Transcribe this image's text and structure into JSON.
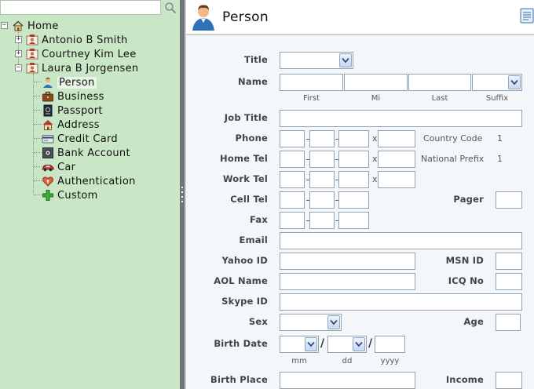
{
  "search": {
    "value": "",
    "placeholder": ""
  },
  "tree": {
    "root": "Home",
    "contacts": [
      {
        "name": "Antonio B Smith"
      },
      {
        "name": "Courtney Kim Lee"
      },
      {
        "name": "Laura B Jorgensen"
      }
    ],
    "children": [
      {
        "label": "Person",
        "icon": "person-icon"
      },
      {
        "label": "Business",
        "icon": "briefcase-icon"
      },
      {
        "label": "Passport",
        "icon": "passport-icon"
      },
      {
        "label": "Address",
        "icon": "house-icon"
      },
      {
        "label": "Credit Card",
        "icon": "credit-card-icon"
      },
      {
        "label": "Bank Account",
        "icon": "safe-icon"
      },
      {
        "label": "Car",
        "icon": "car-icon"
      },
      {
        "label": "Authentication",
        "icon": "heart-key-icon"
      },
      {
        "label": "Custom",
        "icon": "plus-icon"
      }
    ],
    "expander_collapsed": "+",
    "expander_expanded": "−"
  },
  "panel": {
    "title": "Person",
    "fields": {
      "title": "Title",
      "name": "Name",
      "name_first": "First",
      "name_mi": "Mi",
      "name_last": "Last",
      "name_suffix": "Suffix",
      "job_title": "Job Title",
      "phone": "Phone",
      "home_tel": "Home Tel",
      "work_tel": "Work Tel",
      "cell_tel": "Cell Tel",
      "pager": "Pager",
      "fax": "Fax",
      "email": "Email",
      "yahoo_id": "Yahoo ID",
      "msn_id": "MSN ID",
      "aol_name": "AOL Name",
      "icq_no": "ICQ No",
      "skype_id": "Skype ID",
      "sex": "Sex",
      "age": "Age",
      "birth_date": "Birth Date",
      "birth_mm": "mm",
      "birth_dd": "dd",
      "birth_yyyy": "yyyy",
      "birth_place": "Birth Place",
      "income": "Income"
    },
    "ext_marker": "x",
    "country_code_label": "Country Code",
    "country_code_value": "1",
    "national_prefix_label": "National Prefix",
    "national_prefix_value": "1",
    "date_separator": "/"
  },
  "colors": {
    "tree_bg": "#c9e6c6",
    "splitter": "#6f7477",
    "form_bg": "#f4f7fa",
    "input_border": "#8fa3b5"
  }
}
